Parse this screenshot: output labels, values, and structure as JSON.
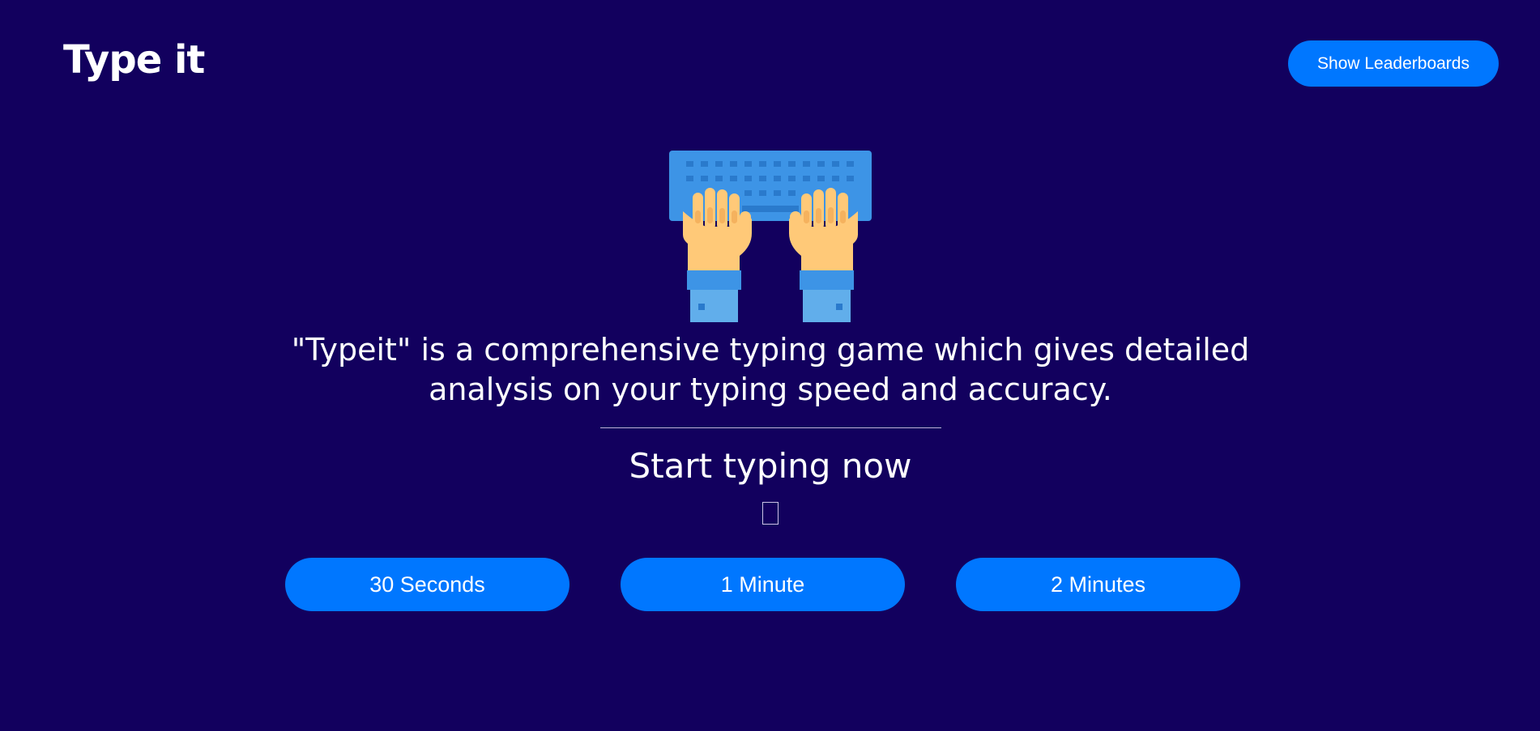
{
  "header": {
    "logo_text": "Type it",
    "leaderboard_button": "Show Leaderboards"
  },
  "hero": {
    "illustration": "hands-typing-on-keyboard",
    "description": "\"Typeit\" is a comprehensive typing game which gives detailed analysis on your typing speed and accuracy.",
    "start_heading": "Start typing now"
  },
  "durations": [
    {
      "label": "30 Seconds"
    },
    {
      "label": "1 Minute"
    },
    {
      "label": "2 Minutes"
    }
  ],
  "colors": {
    "background": "#12005e",
    "accent": "#0077ff",
    "keyboard": "#3d94e6",
    "skin": "#ffc978"
  }
}
